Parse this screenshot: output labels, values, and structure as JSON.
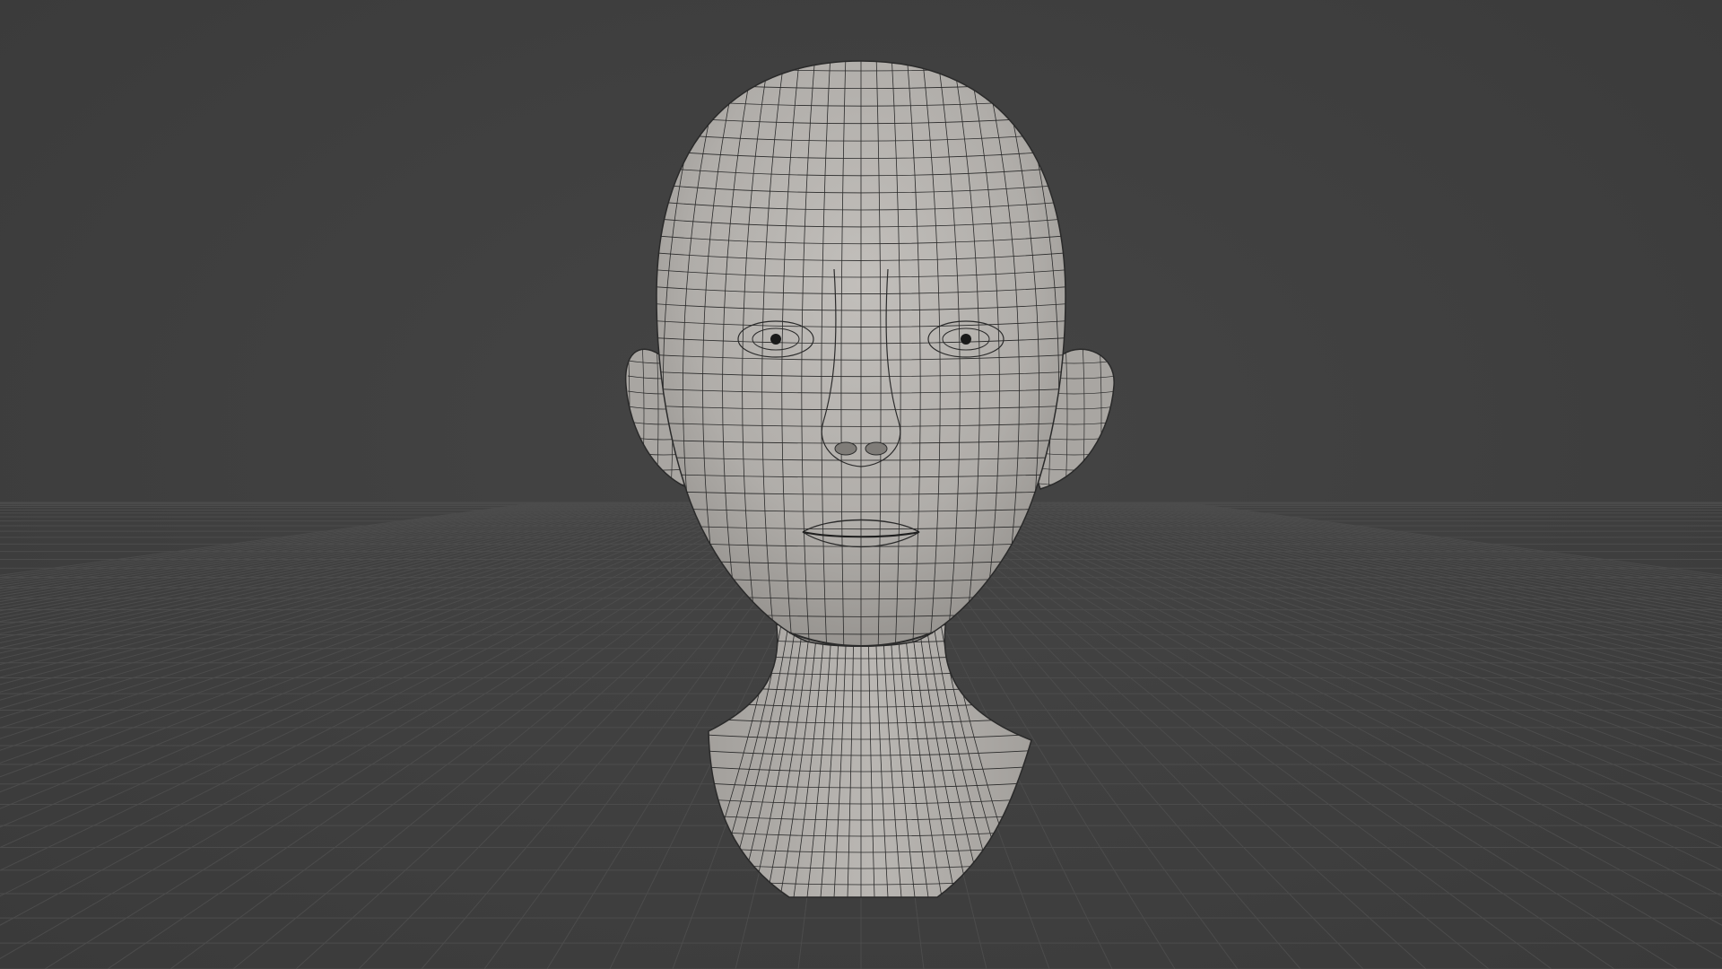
{
  "scene": {
    "background_color": "#3f3f3f",
    "grid_color": "#4c4c4c",
    "mesh_fill": "#b3b0ac",
    "mesh_shadow": "#8f8c88",
    "wire_color": "#2a2a2a",
    "object": "head-mesh"
  }
}
